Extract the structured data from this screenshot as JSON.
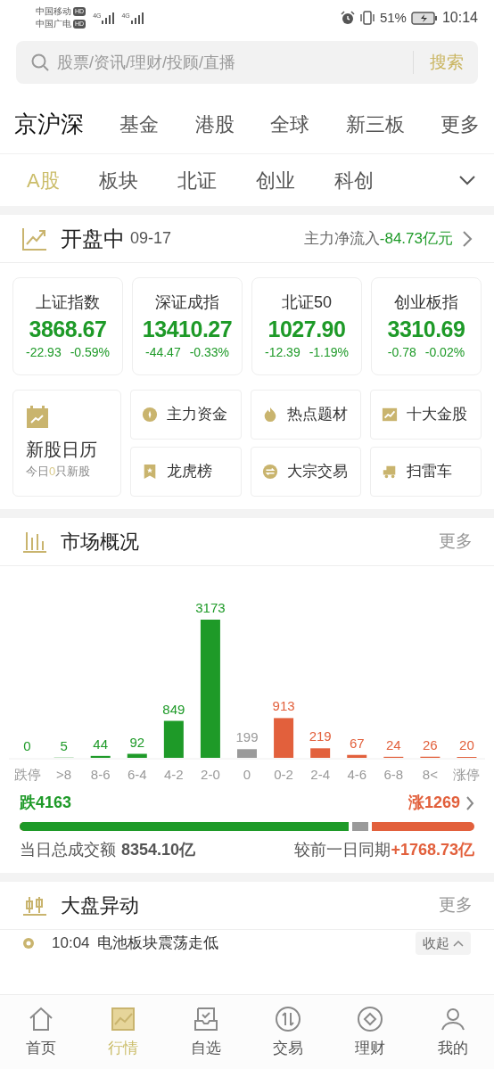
{
  "status_bar": {
    "carriers": [
      "中国移动",
      "中国广电"
    ],
    "hd": [
      "HD",
      "HD"
    ],
    "network": [
      "4G",
      "4G"
    ],
    "battery": "51%",
    "time": "10:14"
  },
  "search": {
    "placeholder": "股票/资讯/理财/投顾/直播",
    "button": "搜索"
  },
  "market_tabs": [
    {
      "label": "京沪深",
      "selected": true
    },
    {
      "label": "基金",
      "selected": false
    },
    {
      "label": "港股",
      "selected": false
    },
    {
      "label": "全球",
      "selected": false
    },
    {
      "label": "新三板",
      "selected": false
    },
    {
      "label": "更多",
      "selected": false
    }
  ],
  "sub_tabs": [
    {
      "label": "A股",
      "selected": true
    },
    {
      "label": "板块",
      "selected": false
    },
    {
      "label": "北证",
      "selected": false
    },
    {
      "label": "创业",
      "selected": false
    },
    {
      "label": "科创",
      "selected": false
    }
  ],
  "session": {
    "title": "开盘中",
    "date": "09-17",
    "flow_label": "主力净流入",
    "flow_value": "-84.73亿元"
  },
  "indices": [
    {
      "name": "上证指数",
      "value": "3868.67",
      "change": "-22.93",
      "percent": "-0.59%"
    },
    {
      "name": "深证成指",
      "value": "13410.27",
      "change": "-44.47",
      "percent": "-0.33%"
    },
    {
      "name": "北证50",
      "value": "1027.90",
      "change": "-12.39",
      "percent": "-1.19%"
    },
    {
      "name": "创业板指",
      "value": "3310.69",
      "change": "-0.78",
      "percent": "-0.02%"
    }
  ],
  "ipo_calendar": {
    "title": "新股日历",
    "subtitle": [
      {
        "text": "今日",
        "highlight": false
      },
      {
        "text": "0",
        "highlight": true
      },
      {
        "text": "只新股",
        "highlight": false
      }
    ]
  },
  "shortcuts": [
    {
      "label": "主力资金",
      "kind": "coin"
    },
    {
      "label": "热点题材",
      "kind": "flame"
    },
    {
      "label": "十大金股",
      "kind": "trend"
    },
    {
      "label": "龙虎榜",
      "kind": "ribbon"
    },
    {
      "label": "大宗交易",
      "kind": "swap"
    },
    {
      "label": "扫雷车",
      "kind": "truck"
    }
  ],
  "overview": {
    "title": "市场概况",
    "more": "更多",
    "chart_data": {
      "type": "bar",
      "categories": [
        "跌停",
        ">8",
        "8-6",
        "6-4",
        "4-2",
        "2-0",
        "0",
        "0-2",
        "2-4",
        "4-6",
        "6-8",
        "8<",
        "涨停"
      ],
      "stacked": true,
      "data_labels": true,
      "series": [
        {
          "color": "#1e9a28",
          "values": [
            0,
            5,
            44,
            92,
            849,
            3173,
            null,
            null,
            null,
            null,
            null,
            null,
            null
          ]
        },
        {
          "color": "#9a9a9a",
          "values": [
            null,
            null,
            null,
            null,
            null,
            null,
            199,
            null,
            null,
            null,
            null,
            null,
            null
          ]
        },
        {
          "color": "#e2603c",
          "values": [
            null,
            null,
            null,
            null,
            null,
            null,
            null,
            913,
            219,
            67,
            24,
            26,
            20
          ]
        }
      ]
    },
    "fall": "跌4163",
    "rise": "涨1269",
    "ratio": {
      "level": 0.775
    },
    "turnover_label": "当日总成交额",
    "turnover_value": "8354.10亿",
    "compare_label": "较前一日同期",
    "compare_value": "+1768.73亿"
  },
  "movements": {
    "title": "大盘异动",
    "more": "更多",
    "items": [
      {
        "time": "10:04",
        "text": "电池板块震荡走低",
        "action": "收起"
      }
    ]
  },
  "nav": [
    {
      "label": "首页",
      "kind": "home",
      "selected": false
    },
    {
      "label": "行情",
      "kind": "chart",
      "selected": true
    },
    {
      "label": "自选",
      "kind": "watch",
      "selected": false
    },
    {
      "label": "交易",
      "kind": "trade",
      "selected": false
    },
    {
      "label": "理财",
      "kind": "wealth",
      "selected": false
    },
    {
      "label": "我的",
      "kind": "user",
      "selected": false
    }
  ]
}
